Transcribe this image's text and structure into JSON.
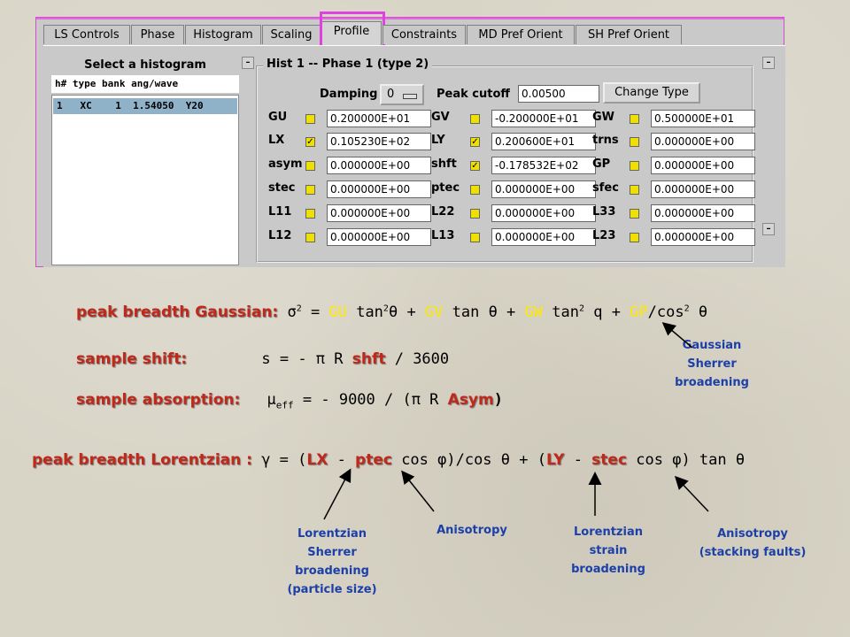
{
  "tabs": [
    "LS Controls",
    "Phase",
    "Histogram",
    "Scaling",
    "Profile",
    "Constraints",
    "MD Pref Orient",
    "SH Pref Orient"
  ],
  "hist_panel": {
    "title": "Select a histogram",
    "header": "h# type bank ang/wave",
    "row": "1   XC    1  1.54050  Y20"
  },
  "phase_box": {
    "title": "Hist 1 -- Phase 1 (type 2)",
    "damping_label": "Damping",
    "damping_value": "0",
    "peak_cutoff_label": "Peak cutoff",
    "peak_cutoff_value": "0.00500",
    "change_type": "Change Type",
    "params": [
      {
        "name": "GU",
        "checked": false,
        "value": "0.200000E+01"
      },
      {
        "name": "GV",
        "checked": false,
        "value": "-0.200000E+01"
      },
      {
        "name": "GW",
        "checked": false,
        "value": "0.500000E+01"
      },
      {
        "name": "LX",
        "checked": true,
        "value": "0.105230E+02"
      },
      {
        "name": "LY",
        "checked": true,
        "value": "0.200600E+01"
      },
      {
        "name": "trns",
        "checked": false,
        "value": "0.000000E+00"
      },
      {
        "name": "asym",
        "checked": false,
        "value": "0.000000E+00"
      },
      {
        "name": "shft",
        "checked": true,
        "value": "-0.178532E+02"
      },
      {
        "name": "GP",
        "checked": false,
        "value": "0.000000E+00"
      },
      {
        "name": "stec",
        "checked": false,
        "value": "0.000000E+00"
      },
      {
        "name": "ptec",
        "checked": false,
        "value": "0.000000E+00"
      },
      {
        "name": "sfec",
        "checked": false,
        "value": "0.000000E+00"
      },
      {
        "name": "L11",
        "checked": false,
        "value": "0.000000E+00"
      },
      {
        "name": "L22",
        "checked": false,
        "value": "0.000000E+00"
      },
      {
        "name": "L33",
        "checked": false,
        "value": "0.000000E+00"
      },
      {
        "name": "L12",
        "checked": false,
        "value": "0.000000E+00"
      },
      {
        "name": "L13",
        "checked": false,
        "value": "0.000000E+00"
      },
      {
        "name": "L23",
        "checked": false,
        "value": "0.000000E+00"
      }
    ]
  },
  "annotations": {
    "gauss_label": "peak breadth Gaussian:",
    "gauss_sigma": "σ",
    "gauss_sup2": "2",
    "gauss_eq1": " = ",
    "gauss_gu": "GU",
    "gauss_tan": " tan",
    "gauss_theta": "θ",
    "gauss_plus": " + ",
    "gauss_gv": "GV",
    "gauss_tan_theta": " tan θ + ",
    "gauss_gw": "GW",
    "gauss_tan2q": " tan",
    "gauss_q": " q + ",
    "gauss_gp": "GP",
    "gauss_cos": "/cos",
    "gauss_end": " θ",
    "shift_label": "sample shift:",
    "shift_eq_pre": "s = - π R ",
    "shift_shft": "shft",
    "shift_eq_post": " / 3600",
    "abs_label": "sample absorption:",
    "abs_mu": "μ",
    "abs_eff": "eff",
    "abs_eq_pre": " = - 9000 / (π R ",
    "abs_asym": "Asym",
    "abs_close": ")",
    "lor_label": "peak breadth Lorentzian :",
    "lor_gamma": "γ = (",
    "lor_lx": "LX",
    "lor_minus1": " - ",
    "lor_ptec": "ptec",
    "lor_mid": " cos φ)/cos θ + (",
    "lor_ly": "LY",
    "lor_minus2": " - ",
    "lor_stec": "stec",
    "lor_end": " cos φ) tan θ"
  },
  "notes": {
    "gauss_sherrer": [
      "Gaussian",
      "Sherrer",
      "broadening"
    ],
    "lor_sherrer": [
      "Lorentzian",
      "Sherrer",
      "broadening",
      "(particle size)"
    ],
    "aniso1": [
      "Anisotropy"
    ],
    "lor_strain": [
      "Lorentzian",
      "strain",
      "broadening"
    ],
    "aniso2": [
      "Anisotropy",
      "(stacking faults)"
    ]
  }
}
